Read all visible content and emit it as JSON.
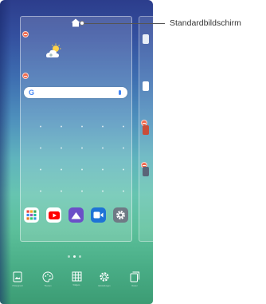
{
  "callout": {
    "label": "Standardbildschirm"
  },
  "search": {
    "logo": "G"
  },
  "dock_apps": [
    {
      "icon": "apps-grid-icon",
      "color": "#ffffff"
    },
    {
      "icon": "youtube-icon",
      "color": "#ff0000"
    },
    {
      "icon": "gallery-icon",
      "color": "#6b4fc8"
    },
    {
      "icon": "video-camera-icon",
      "color": "#1e73d6"
    },
    {
      "icon": "settings-icon",
      "color": "#6f7a85"
    }
  ],
  "bottom_menu": [
    {
      "icon": "wallpaper-icon",
      "label": "Hintergrund"
    },
    {
      "icon": "theme-icon",
      "label": "Themen"
    },
    {
      "icon": "widgets-icon",
      "label": "Widgets"
    },
    {
      "icon": "settings-gear-icon",
      "label": "Einstellungen"
    },
    {
      "icon": "screen-grid-icon",
      "label": "Raster"
    }
  ],
  "colors": {
    "remove_badge": "#ef6b50",
    "google_blue": "#4285f4"
  }
}
